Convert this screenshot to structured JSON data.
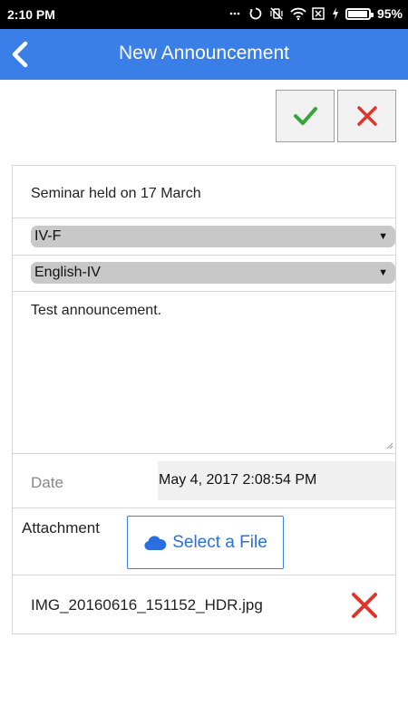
{
  "status_bar": {
    "time": "2:10 PM",
    "battery_percent": "95%",
    "icons": [
      "silent-mode-icon",
      "sync-icon",
      "vibrate-off-icon",
      "wifi-icon",
      "sim-disabled-icon",
      "charging-icon",
      "battery-icon"
    ]
  },
  "app_bar": {
    "title": "New Announcement",
    "back_icon": "chevron-left-icon",
    "color": "#3a7fe8"
  },
  "actions": {
    "confirm_icon": "checkmark-icon",
    "cancel_icon": "close-icon",
    "confirm_color": "#3aa33a",
    "cancel_color": "#e0352b"
  },
  "form": {
    "subject": "Seminar held on 17 March",
    "class_select": {
      "value": "IV-F"
    },
    "subject_select": {
      "value": "English-IV"
    },
    "message": "Test announcement.",
    "date_label": "Date",
    "date_value": "May 4, 2017 2:08:54 PM",
    "attachment_label": "Attachment",
    "select_file_label": "Select a File",
    "select_file_icon": "cloud-icon",
    "attached_file": "IMG_20160616_151152_HDR.jpg",
    "remove_file_icon": "close-icon"
  }
}
